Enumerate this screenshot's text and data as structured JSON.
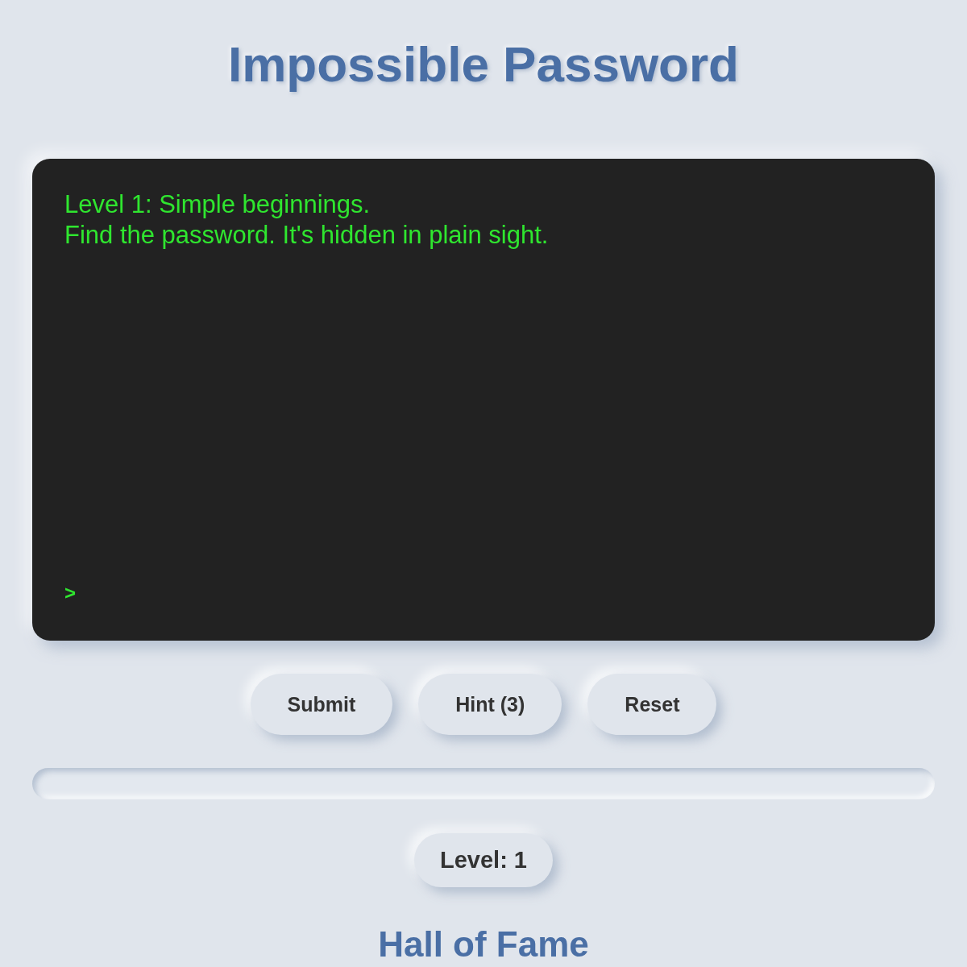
{
  "title": "Impossible Password",
  "terminal": {
    "lines": [
      "Level 1: Simple beginnings.",
      "Find the password. It's hidden in plain sight."
    ],
    "prompt": ">"
  },
  "buttons": [
    "Submit",
    "Hint (3)",
    "Reset"
  ],
  "level_badge": "Level: 1",
  "hall_of_fame": {
    "title": "Hall of Fame"
  }
}
